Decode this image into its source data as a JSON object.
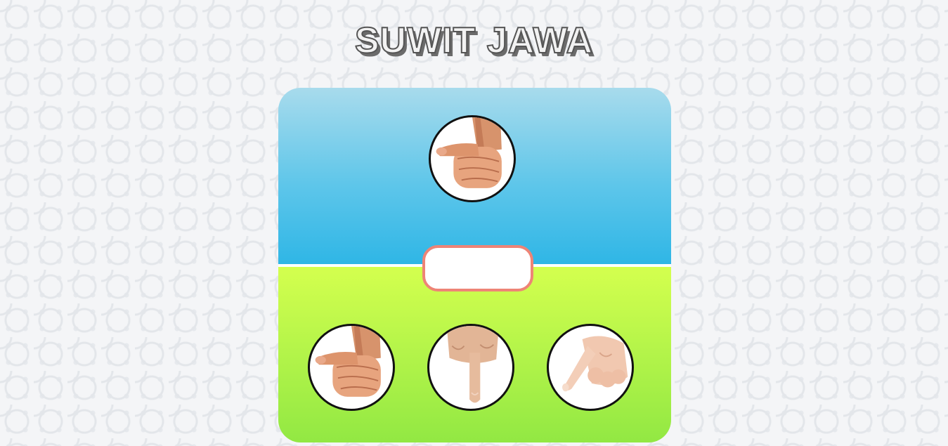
{
  "title": "SUWIT JAWA",
  "computer": {
    "choice": {
      "icon": "gajah-thumb-hand-icon"
    }
  },
  "result": {
    "text": ""
  },
  "player": {
    "choices": [
      {
        "icon": "gajah-thumb-hand-icon"
      },
      {
        "icon": "orang-index-finger-hand-icon"
      },
      {
        "icon": "semut-pinky-finger-hand-icon"
      }
    ]
  },
  "colors": {
    "computer_area": "#2fb6e6",
    "player_area": "#b6f54a",
    "result_border": "#ee8476"
  }
}
